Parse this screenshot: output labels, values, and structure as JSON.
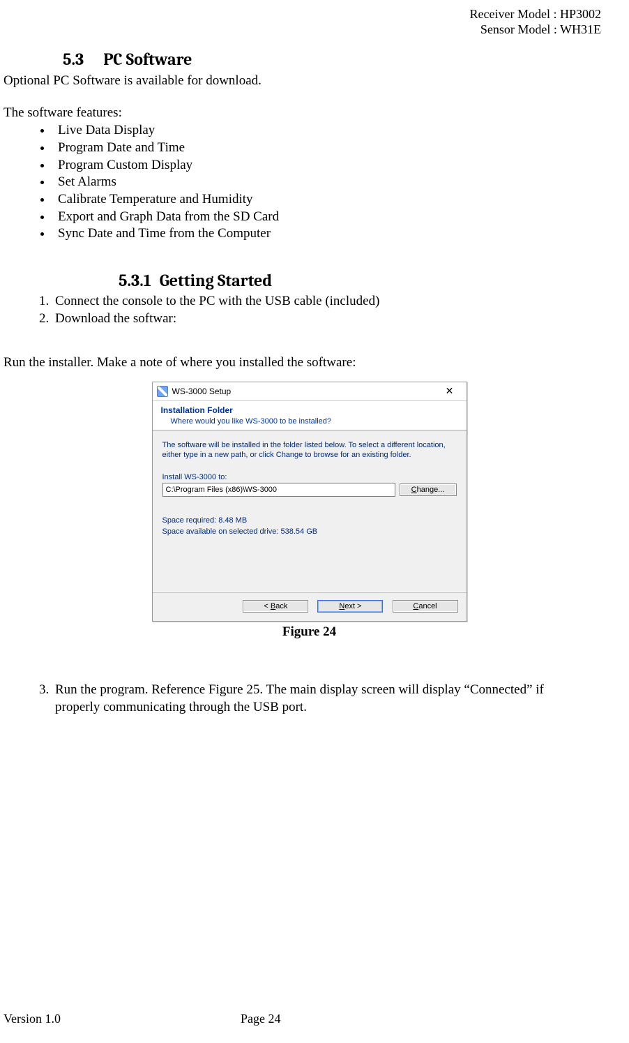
{
  "header": {
    "line1": "Receiver Model : HP3002",
    "line2": "Sensor Model : WH31E"
  },
  "section": {
    "num": "5.3",
    "title": "PC Software"
  },
  "intro": "Optional PC Software is available for download.",
  "features_label": "The software features:",
  "features": [
    "Live Data Display",
    "Program Date and Time",
    "Program Custom Display",
    "Set Alarms",
    "Calibrate Temperature and Humidity",
    "Export and Graph Data from the SD Card",
    "Sync Date and Time from the Computer"
  ],
  "subsection": {
    "num": "5.3.1",
    "title": "Getting Started"
  },
  "steps_a": [
    "Connect the console to the PC with the USB cable (included)",
    "Download the softwar:"
  ],
  "run_installer": "Run the installer. Make a note of where you installed the software:",
  "dialog": {
    "title": "WS-3000 Setup",
    "heading": "Installation Folder",
    "subheading": "Where would you like WS-3000 to be installed?",
    "desc": "The software will be installed in the folder listed below. To select a different location, either type in a new path, or click Change to browse for an existing folder.",
    "install_to_label": "Install WS-3000 to:",
    "path": "C:\\Program Files (x86)\\WS-3000",
    "change": "Change...",
    "space_required": "Space required: 8.48 MB",
    "space_available": "Space available on selected drive: 538.54 GB",
    "back": "< Back",
    "next": "Next >",
    "cancel": "Cancel"
  },
  "figure_caption": "Figure 24",
  "steps_b": [
    "Run the program. Reference Figure 25.    The main display screen will display “Connected” if properly communicating through the USB port."
  ],
  "footer": {
    "version": "Version 1.0",
    "page": "Page 24"
  }
}
